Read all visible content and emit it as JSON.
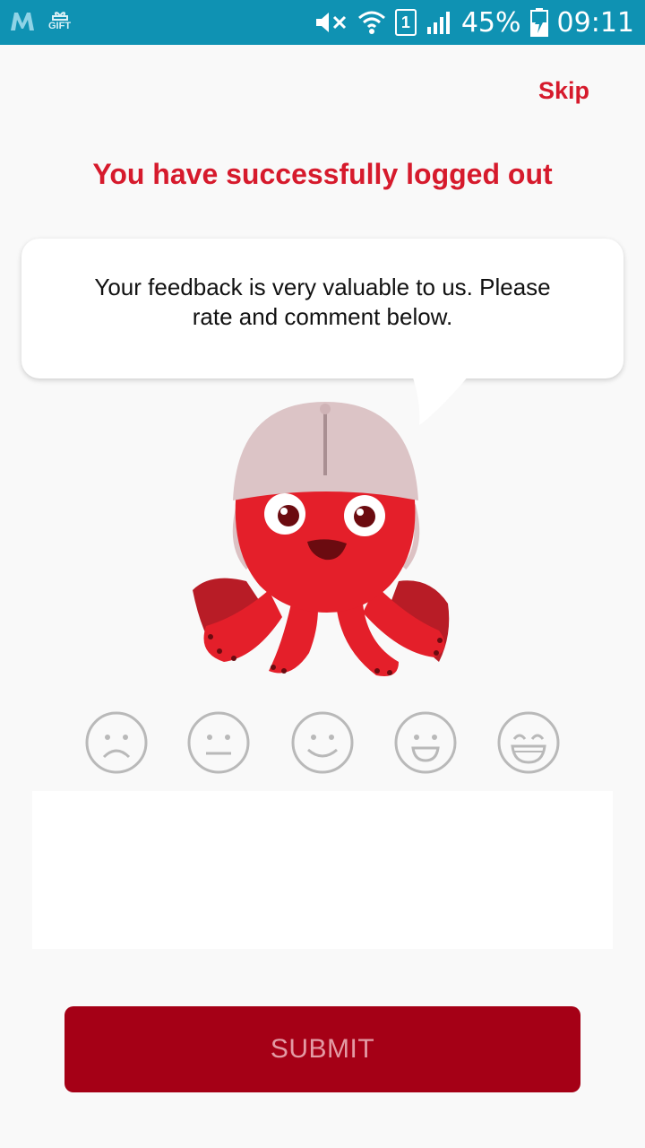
{
  "status_bar": {
    "battery_percent": "45%",
    "time": "09:11",
    "sim_slot": "1",
    "left_icons": [
      "app-m-icon",
      "gift-icon"
    ],
    "right_icons": [
      "mute-icon",
      "wifi-icon",
      "sim-icon",
      "signal-icon",
      "battery-charging-icon"
    ],
    "gift_text": "GIFT"
  },
  "header": {
    "skip_label": "Skip",
    "title": "You have successfully logged out"
  },
  "bubble": {
    "text": "Your feedback is very valuable to us. Please rate and comment below."
  },
  "ratings": {
    "options": [
      "very-sad-face-icon",
      "neutral-face-icon",
      "slight-smile-face-icon",
      "smile-face-icon",
      "grin-face-icon"
    ]
  },
  "comment": {
    "value": "",
    "placeholder": ""
  },
  "submit": {
    "label": "SUBMIT"
  },
  "colors": {
    "status_bar": "#0f92b3",
    "accent": "#d61a2c",
    "submit_bg": "#a50016",
    "submit_text": "#e39aa4",
    "face_stroke": "#b9b9b9"
  }
}
